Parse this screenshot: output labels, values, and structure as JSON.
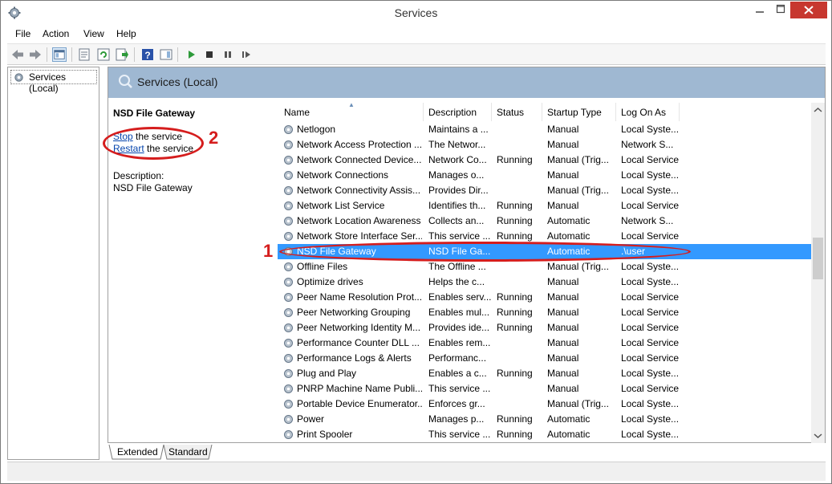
{
  "window": {
    "title": "Services",
    "icon": "gear-icon"
  },
  "menu": [
    "File",
    "Action",
    "View",
    "Help"
  ],
  "tree": {
    "root_label": "Services (Local)"
  },
  "pane": {
    "header": "Services (Local)"
  },
  "extended": {
    "service_name": "NSD File Gateway",
    "stop_link": "Stop",
    "stop_suffix": " the service",
    "restart_link": "Restart",
    "restart_suffix": " the service",
    "description_label": "Description:",
    "description_value": "NSD File Gateway"
  },
  "columns": {
    "name": "Name",
    "description": "Description",
    "status": "Status",
    "startup_type": "Startup Type",
    "log_on_as": "Log On As"
  },
  "rows": [
    {
      "name": "Netlogon",
      "description": "Maintains a ...",
      "status": "",
      "startup": "Manual",
      "logon": "Local Syste..."
    },
    {
      "name": "Network Access Protection ...",
      "description": "The Networ...",
      "status": "",
      "startup": "Manual",
      "logon": "Network S..."
    },
    {
      "name": "Network Connected Device...",
      "description": "Network Co...",
      "status": "Running",
      "startup": "Manual (Trig...",
      "logon": "Local Service"
    },
    {
      "name": "Network Connections",
      "description": "Manages o...",
      "status": "",
      "startup": "Manual",
      "logon": "Local Syste..."
    },
    {
      "name": "Network Connectivity Assis...",
      "description": "Provides Dir...",
      "status": "",
      "startup": "Manual (Trig...",
      "logon": "Local Syste..."
    },
    {
      "name": "Network List Service",
      "description": "Identifies th...",
      "status": "Running",
      "startup": "Manual",
      "logon": "Local Service"
    },
    {
      "name": "Network Location Awareness",
      "description": "Collects an...",
      "status": "Running",
      "startup": "Automatic",
      "logon": "Network S..."
    },
    {
      "name": "Network Store Interface Ser...",
      "description": "This service ...",
      "status": "Running",
      "startup": "Automatic",
      "logon": "Local Service"
    },
    {
      "name": "NSD File Gateway",
      "description": "NSD File Ga...",
      "status": "",
      "startup": "Automatic",
      "logon": ".\\user",
      "selected": true
    },
    {
      "name": "Offline Files",
      "description": "The Offline ...",
      "status": "",
      "startup": "Manual (Trig...",
      "logon": "Local Syste..."
    },
    {
      "name": "Optimize drives",
      "description": "Helps the c...",
      "status": "",
      "startup": "Manual",
      "logon": "Local Syste..."
    },
    {
      "name": "Peer Name Resolution Prot...",
      "description": "Enables serv...",
      "status": "Running",
      "startup": "Manual",
      "logon": "Local Service"
    },
    {
      "name": "Peer Networking Grouping",
      "description": "Enables mul...",
      "status": "Running",
      "startup": "Manual",
      "logon": "Local Service"
    },
    {
      "name": "Peer Networking Identity M...",
      "description": "Provides ide...",
      "status": "Running",
      "startup": "Manual",
      "logon": "Local Service"
    },
    {
      "name": "Performance Counter DLL ...",
      "description": "Enables rem...",
      "status": "",
      "startup": "Manual",
      "logon": "Local Service"
    },
    {
      "name": "Performance Logs & Alerts",
      "description": "Performanc...",
      "status": "",
      "startup": "Manual",
      "logon": "Local Service"
    },
    {
      "name": "Plug and Play",
      "description": "Enables a c...",
      "status": "Running",
      "startup": "Manual",
      "logon": "Local Syste..."
    },
    {
      "name": "PNRP Machine Name Publi...",
      "description": "This service ...",
      "status": "",
      "startup": "Manual",
      "logon": "Local Service"
    },
    {
      "name": "Portable Device Enumerator...",
      "description": "Enforces gr...",
      "status": "",
      "startup": "Manual (Trig...",
      "logon": "Local Syste..."
    },
    {
      "name": "Power",
      "description": "Manages p...",
      "status": "Running",
      "startup": "Automatic",
      "logon": "Local Syste..."
    },
    {
      "name": "Print Spooler",
      "description": "This service ...",
      "status": "Running",
      "startup": "Automatic",
      "logon": "Local Syste..."
    }
  ],
  "tabs": [
    "Extended",
    "Standard"
  ],
  "annotations": {
    "marker_1": "1",
    "marker_2": "2",
    "color": "#d51d1d"
  },
  "colors": {
    "selection": "#3399ff",
    "header_band": "#9fb8d2",
    "link": "#0645ad",
    "close_button": "#c7372f"
  }
}
